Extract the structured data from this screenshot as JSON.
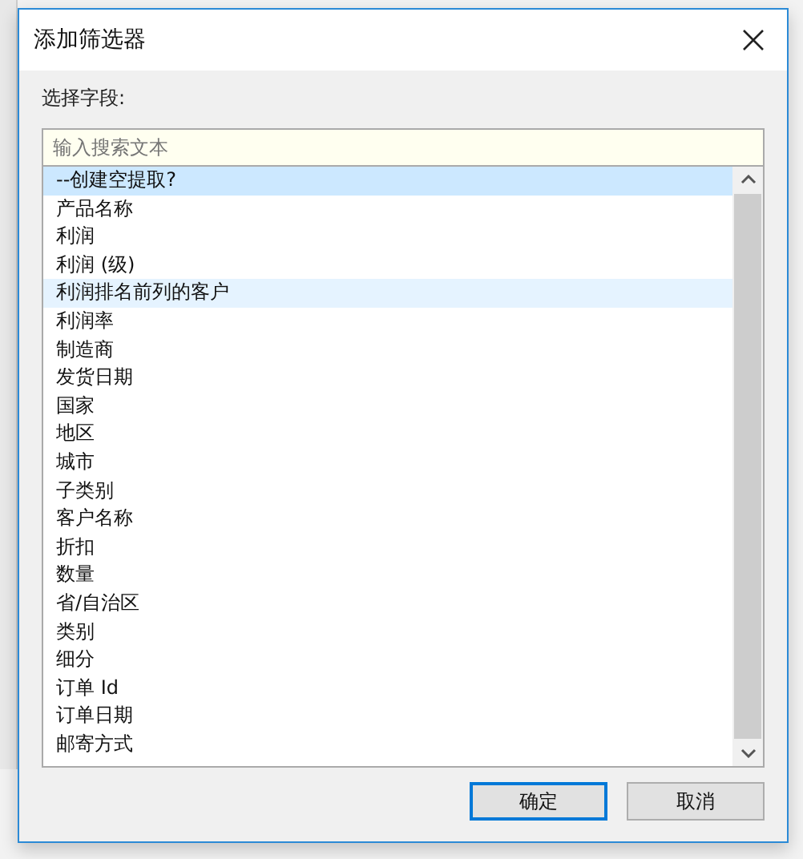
{
  "window": {
    "title": "添加筛选器"
  },
  "field_label": "选择字段:",
  "search": {
    "placeholder": "输入搜索文本"
  },
  "fields": [
    {
      "label": "--创建空提取?",
      "selected": true,
      "hovered": false
    },
    {
      "label": "产品名称",
      "selected": false,
      "hovered": false
    },
    {
      "label": "利润",
      "selected": false,
      "hovered": false
    },
    {
      "label": "利润 (级)",
      "selected": false,
      "hovered": false
    },
    {
      "label": "利润排名前列的客户",
      "selected": false,
      "hovered": true
    },
    {
      "label": "利润率",
      "selected": false,
      "hovered": false
    },
    {
      "label": "制造商",
      "selected": false,
      "hovered": false
    },
    {
      "label": "发货日期",
      "selected": false,
      "hovered": false
    },
    {
      "label": "国家",
      "selected": false,
      "hovered": false
    },
    {
      "label": "地区",
      "selected": false,
      "hovered": false
    },
    {
      "label": "城市",
      "selected": false,
      "hovered": false
    },
    {
      "label": "子类别",
      "selected": false,
      "hovered": false
    },
    {
      "label": "客户名称",
      "selected": false,
      "hovered": false
    },
    {
      "label": "折扣",
      "selected": false,
      "hovered": false
    },
    {
      "label": "数量",
      "selected": false,
      "hovered": false
    },
    {
      "label": "省/自治区",
      "selected": false,
      "hovered": false
    },
    {
      "label": "类别",
      "selected": false,
      "hovered": false
    },
    {
      "label": "细分",
      "selected": false,
      "hovered": false
    },
    {
      "label": "订单 Id",
      "selected": false,
      "hovered": false
    },
    {
      "label": "订单日期",
      "selected": false,
      "hovered": false
    },
    {
      "label": "邮寄方式",
      "selected": false,
      "hovered": false
    }
  ],
  "buttons": [
    {
      "label": "确定",
      "default": true
    },
    {
      "label": "取消",
      "default": false
    }
  ]
}
